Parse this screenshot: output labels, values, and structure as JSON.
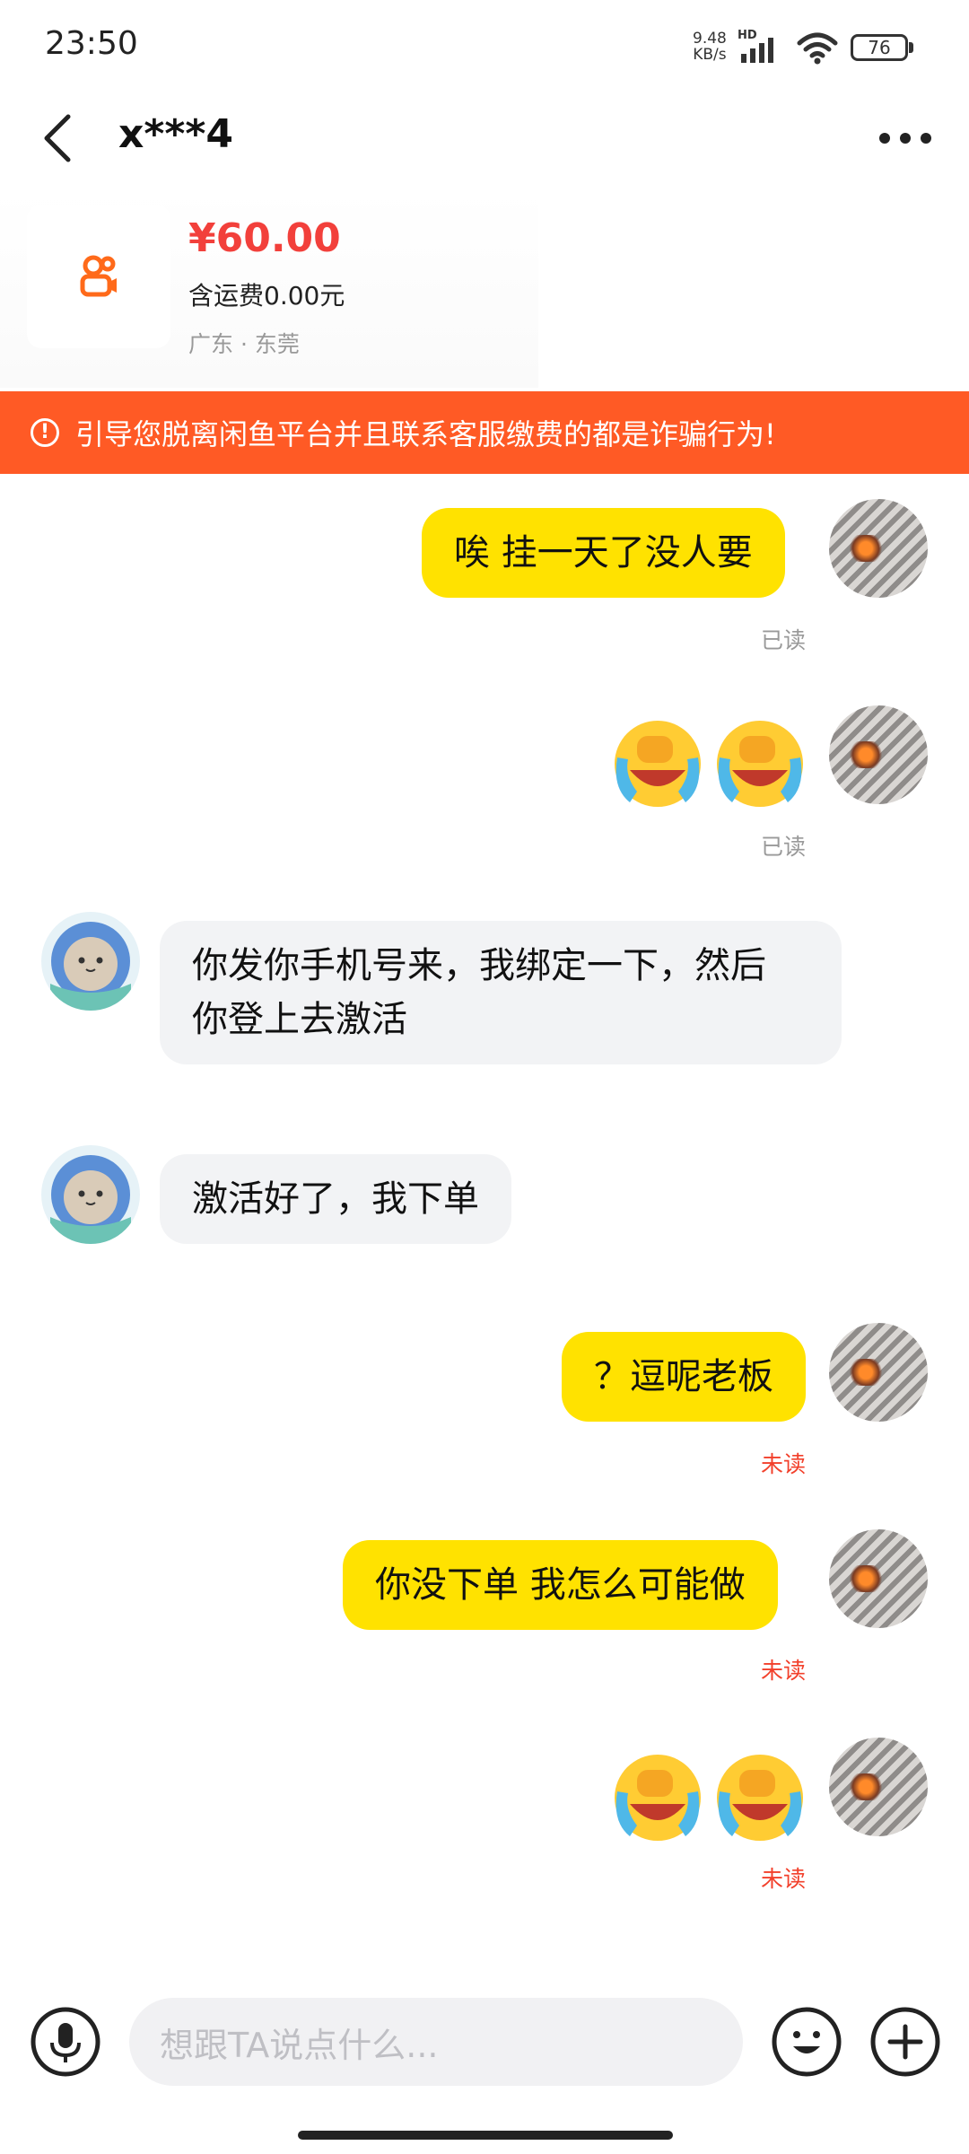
{
  "status_bar": {
    "time": "23:50",
    "net_speed_value": "9.48",
    "net_speed_unit": "KB/s",
    "hd_label": "HD",
    "battery": "76"
  },
  "header": {
    "title": "x***4"
  },
  "product": {
    "price": "¥60.00",
    "shipping": "含运费0.00元",
    "location": "广东 · 东莞"
  },
  "warning": {
    "text": "引导您脱离闲鱼平台并且联系客服缴费的都是诈骗行为!"
  },
  "messages": [
    {
      "from": "me",
      "text": "唉 挂一天了没人要",
      "status": "已读"
    },
    {
      "from": "me",
      "emoji": "laughing-crying-emoji x2",
      "status": "已读"
    },
    {
      "from": "other",
      "text_line1": "你发你手机号来，我绑定一下，然后",
      "text_line2": "你登上去激活"
    },
    {
      "from": "other",
      "text": "激活好了，我下单"
    },
    {
      "from": "me",
      "text": "？逗呢老板",
      "status": "未读"
    },
    {
      "from": "me",
      "text": "你没下单 我怎么可能做",
      "status": "未读"
    },
    {
      "from": "me",
      "emoji": "laughing-crying-emoji x2",
      "status": "未读"
    }
  ],
  "input": {
    "placeholder": "想跟TA说点什么..."
  },
  "colors": {
    "accent_yellow": "#ffe200",
    "warning_orange": "#ff5a25",
    "price_red": "#f2403b",
    "unread_red": "#f2402b"
  }
}
